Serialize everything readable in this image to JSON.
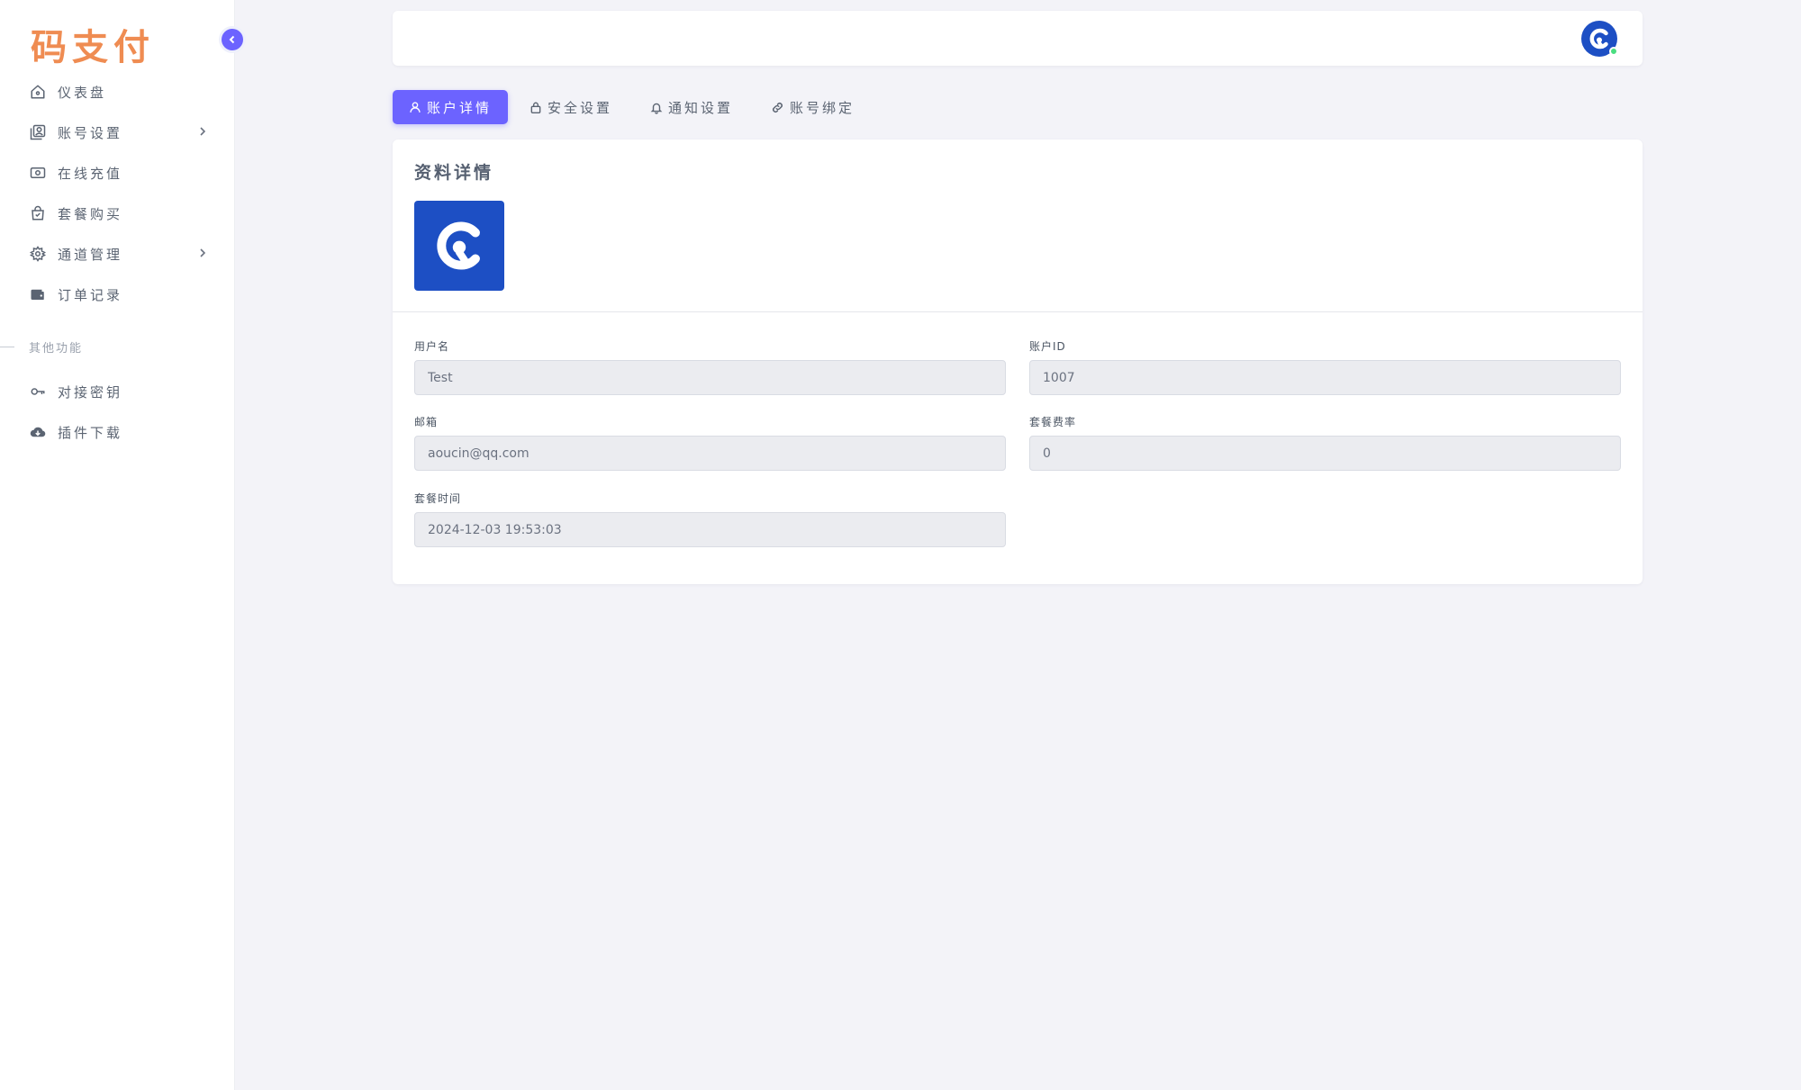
{
  "brand": {
    "logo_text": "码支付",
    "accent_color": "#6c63ff",
    "logo_color": "#ef8c52"
  },
  "sidebar": {
    "items": [
      {
        "label": "仪表盘",
        "icon": "home-icon",
        "has_submenu": false
      },
      {
        "label": "账号设置",
        "icon": "account-card-icon",
        "has_submenu": true
      },
      {
        "label": "在线充值",
        "icon": "cash-icon",
        "has_submenu": false
      },
      {
        "label": "套餐购买",
        "icon": "shopping-bag-icon",
        "has_submenu": false
      },
      {
        "label": "通道管理",
        "icon": "gear-icon",
        "has_submenu": true
      },
      {
        "label": "订单记录",
        "icon": "wallet-icon",
        "has_submenu": false
      }
    ],
    "section_label": "其他功能",
    "other_items": [
      {
        "label": "对接密钥",
        "icon": "key-icon"
      },
      {
        "label": "插件下载",
        "icon": "cloud-download-icon"
      }
    ]
  },
  "tabs": [
    {
      "label": "账户详情",
      "icon": "user-icon",
      "active": true
    },
    {
      "label": "安全设置",
      "icon": "lock-icon",
      "active": false
    },
    {
      "label": "通知设置",
      "icon": "bell-icon",
      "active": false
    },
    {
      "label": "账号绑定",
      "icon": "link-icon",
      "active": false
    }
  ],
  "card": {
    "title": "资料详情",
    "fields": {
      "username": {
        "label": "用户名",
        "value": "Test"
      },
      "account_id": {
        "label": "账户ID",
        "value": "1007"
      },
      "email": {
        "label": "邮箱",
        "value": "aoucin@qq.com"
      },
      "rate": {
        "label": "套餐费率",
        "value": "0"
      },
      "package_time": {
        "label": "套餐时间",
        "value": "2024-12-03 19:53:03"
      }
    }
  }
}
